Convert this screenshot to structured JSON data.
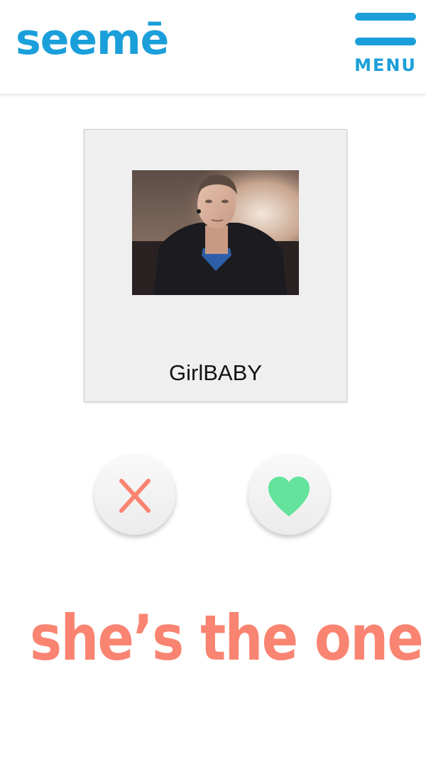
{
  "header": {
    "logo_text": "seemē",
    "menu_label": "MENU"
  },
  "card": {
    "name": "GirlBABY",
    "photo_icon": "webcam-photo"
  },
  "actions": {
    "reject_icon": "x-icon",
    "like_icon": "heart-icon"
  },
  "tagline": "she’s the one!",
  "colors": {
    "brand_blue": "#1a9fda",
    "reject_red": "#f98471",
    "like_green": "#63e39b",
    "tagline_salmon": "#f98471"
  }
}
